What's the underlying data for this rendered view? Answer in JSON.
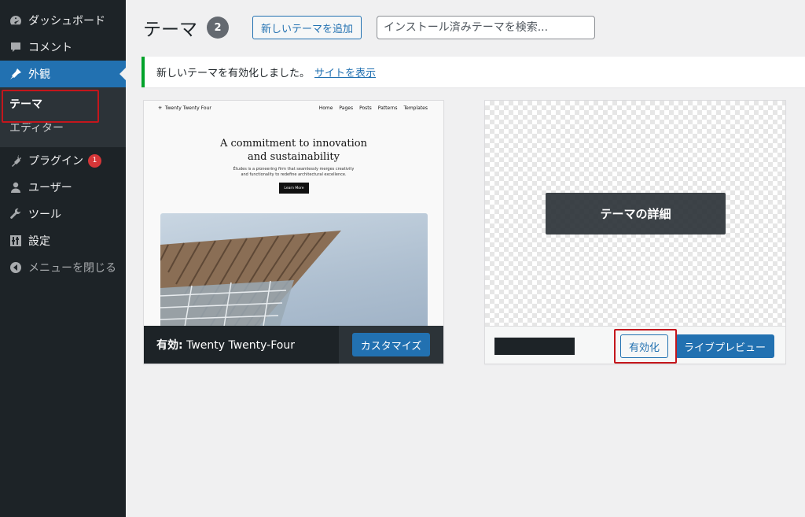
{
  "sidebar": {
    "items": [
      {
        "label": "ダッシュボード",
        "icon": "dashboard-icon"
      },
      {
        "label": "コメント",
        "icon": "comment-icon"
      },
      {
        "label": "外観",
        "icon": "appearance-icon"
      },
      {
        "label": "プラグイン",
        "icon": "plugin-icon",
        "badge": "1"
      },
      {
        "label": "ユーザー",
        "icon": "user-icon"
      },
      {
        "label": "ツール",
        "icon": "wrench-icon"
      },
      {
        "label": "設定",
        "icon": "settings-icon"
      },
      {
        "label": "メニューを閉じる",
        "icon": "collapse-icon"
      }
    ],
    "submenu": [
      "テーマ",
      "エディター"
    ]
  },
  "header": {
    "title": "テーマ",
    "count": "2",
    "add_button": "新しいテーマを追加",
    "search_placeholder": "インストール済みテーマを検索..."
  },
  "notice": {
    "text": "新しいテーマを有効化しました。",
    "link": "サイトを表示"
  },
  "theme_active": {
    "status_label": "有効:",
    "name": "Twenty Twenty-Four",
    "customize_button": "カスタマイズ",
    "preview": {
      "logo": "Twenty Twenty Four",
      "nav": [
        "Home",
        "Pages",
        "Posts",
        "Patterns",
        "Templates"
      ],
      "heading_line1": "A commitment to innovation",
      "heading_line2": "and sustainability",
      "para_line1": "Études is a pioneering firm that seamlessly merges creativity",
      "para_line2": "and functionality to redefine architectural excellence.",
      "cta": "Learn More"
    }
  },
  "theme_other": {
    "details_overlay": "テーマの詳細",
    "activate_button": "有効化",
    "live_preview_button": "ライブプレビュー"
  },
  "colors": {
    "sidebar_bg": "#1d2327",
    "accent": "#2271b1",
    "highlight_box": "#c4161c",
    "notice_border": "#00a32a"
  }
}
